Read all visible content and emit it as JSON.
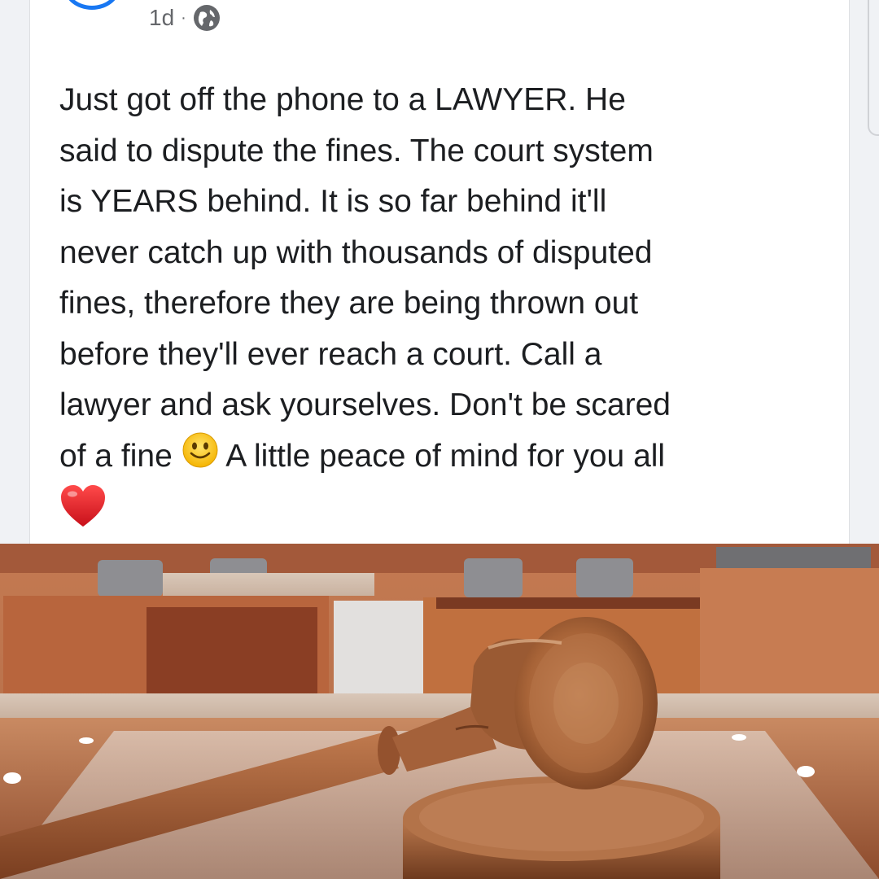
{
  "post": {
    "time": "1d",
    "separator": "·",
    "visibility_icon": "globe-icon",
    "text_lines": [
      "Just got off the phone to a LAWYER. He",
      "said to dispute the fines. The court system",
      "is YEARS behind. It is so far behind it'll",
      "never catch up with thousands of disputed",
      "fines, therefore they are being thrown out",
      "before they'll ever reach a court. Call a",
      "lawyer and ask yourselves. Don't be scared"
    ],
    "text_line_8_before_emoji": "of a fine ",
    "text_line_8_after_emoji": " A little peace of mind for you all",
    "emojis": [
      "slightly-smiling-face",
      "red-heart"
    ],
    "image_subject": "wooden-gavel-in-courtroom"
  },
  "colors": {
    "accent": "#1877f2",
    "text": "#1c1e21",
    "meta": "#65676b",
    "heart": "#e0242b"
  }
}
